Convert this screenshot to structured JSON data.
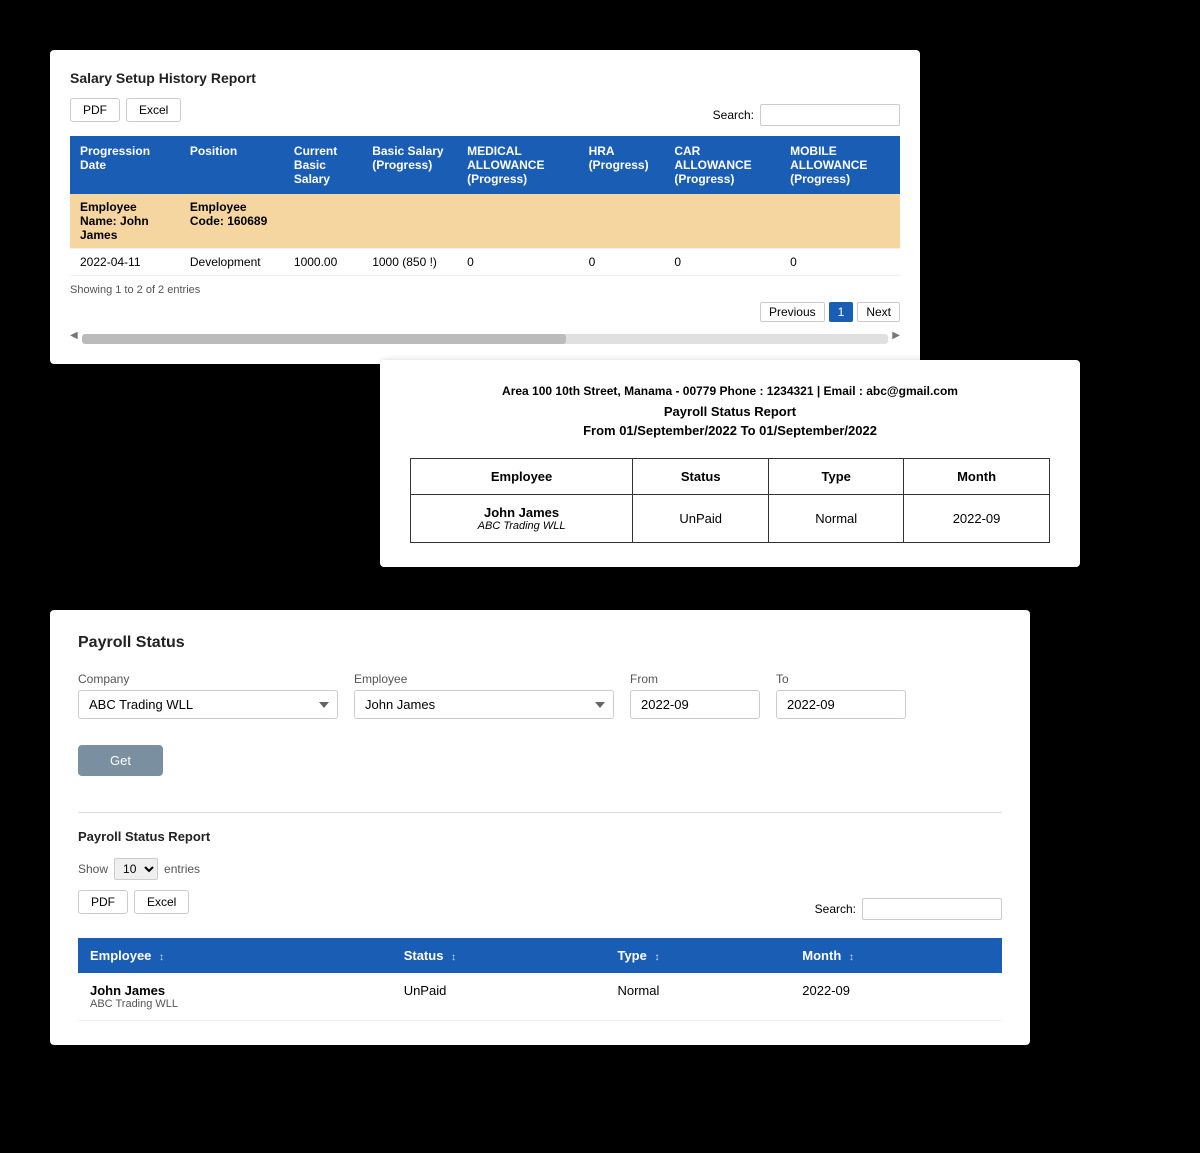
{
  "panel1": {
    "title": "Salary Setup History Report",
    "buttons": [
      "PDF",
      "Excel"
    ],
    "search_label": "Search:",
    "columns": [
      "Progression Date",
      "Position",
      "Current Basic Salary",
      "Basic Salary (Progress)",
      "MEDICAL ALLOWANCE (Progress)",
      "HRA (Progress)",
      "CAR ALLOWANCE (Progress)",
      "MOBILE ALLOWANCE (Progress)"
    ],
    "employee_row": {
      "name": "Employee Name: John James",
      "code": "Employee Code: 160689"
    },
    "data_row": {
      "date": "2022-04-11",
      "position": "Development",
      "current_basic": "1000.00",
      "basic_progress": "1000 (850 !)",
      "medical": "0",
      "hra": "0",
      "car": "0",
      "mobile": "0"
    },
    "showing": "Showing 1 to 2 of 2 entries",
    "pagination": {
      "previous": "Previous",
      "next": "Next",
      "current_page": "1"
    }
  },
  "panel2": {
    "company_info": "Area 100 10th Street, Manama - 00779 Phone : 1234321 | Email : abc@gmail.com",
    "report_title": "Payroll Status Report",
    "date_range": "From 01/September/2022 To 01/September/2022",
    "columns": [
      "Employee",
      "Status",
      "Type",
      "Month"
    ],
    "rows": [
      {
        "employee_name": "John James",
        "employee_company": "ABC Trading WLL",
        "status": "UnPaid",
        "type": "Normal",
        "month": "2022-09"
      }
    ]
  },
  "panel3": {
    "title": "Payroll Status",
    "form": {
      "company_label": "Company",
      "company_value": "ABC Trading WLL",
      "employee_label": "Employee",
      "employee_value": "John James",
      "from_label": "From",
      "from_value": "2022-09",
      "to_label": "To",
      "to_value": "2022-09"
    },
    "get_button": "Get",
    "sub_title": "Payroll Status Report",
    "show_label": "Show",
    "show_value": "10",
    "entries_label": "entries",
    "pdf_btn": "PDF",
    "excel_btn": "Excel",
    "search_label": "Search:",
    "table_columns": [
      {
        "label": "Employee",
        "sort": "↕"
      },
      {
        "label": "Status",
        "sort": "↕"
      },
      {
        "label": "Type",
        "sort": "↕"
      },
      {
        "label": "Month",
        "sort": "↕"
      }
    ],
    "rows": [
      {
        "employee_name": "John James",
        "employee_company": "ABC Trading WLL",
        "status": "UnPaid",
        "type": "Normal",
        "month": "2022-09"
      }
    ]
  }
}
